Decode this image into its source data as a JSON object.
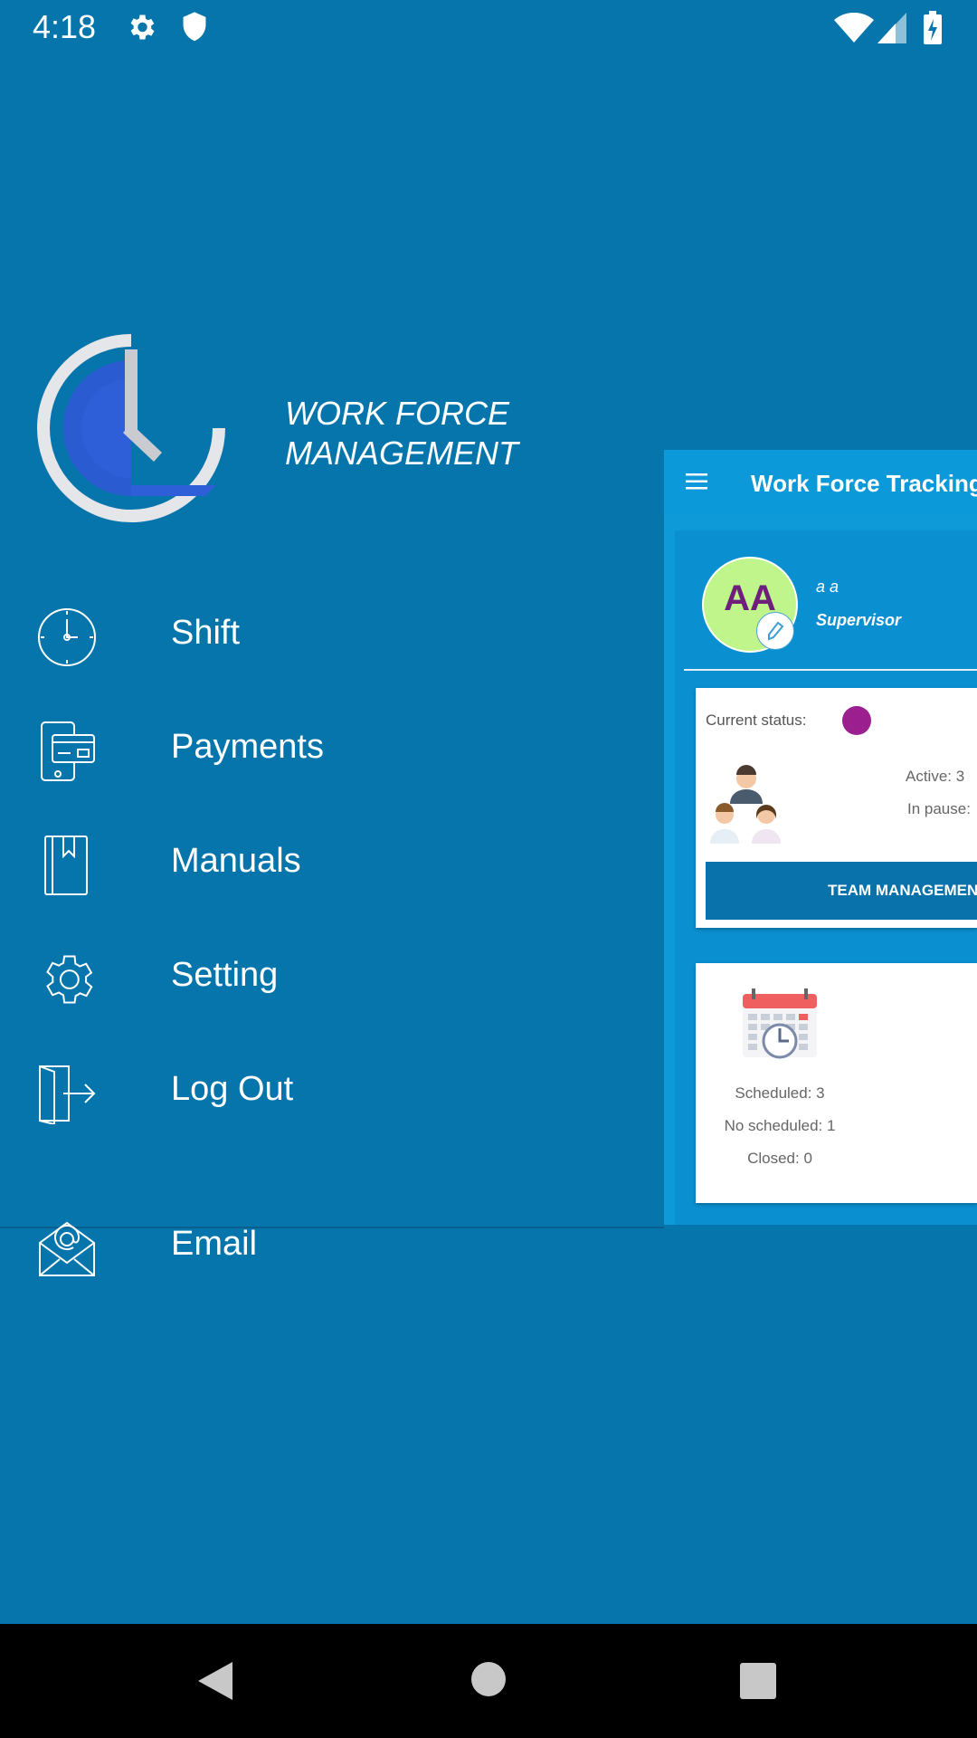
{
  "status_bar": {
    "time": "4:18",
    "icons": [
      "gear-icon",
      "shield-icon",
      "wifi-icon",
      "signal-icon",
      "battery-charging-icon"
    ]
  },
  "drawer": {
    "brand_line1": "WORK FORCE",
    "brand_line2": "MANAGEMENT",
    "menu": [
      {
        "label": "Shift",
        "icon": "clock-icon"
      },
      {
        "label": "Payments",
        "icon": "payments-icon"
      },
      {
        "label": "Manuals",
        "icon": "book-icon"
      },
      {
        "label": "Setting",
        "icon": "gear-icon"
      },
      {
        "label": "Log Out",
        "icon": "logout-icon"
      }
    ],
    "email": {
      "label": "Email",
      "icon": "email-icon"
    }
  },
  "main": {
    "title": "Work Force Tracking",
    "profile": {
      "initials": "AA",
      "name": "a a",
      "role": "Supervisor"
    },
    "status_card": {
      "current_status_label": "Current status:",
      "active": "Active: 3",
      "in_pause": "In pause:",
      "button_label": "TEAM MANAGEMENT"
    },
    "schedule_card": {
      "scheduled": "Scheduled: 3",
      "no_scheduled": "No scheduled: 1",
      "closed": "Closed: 0"
    }
  },
  "colors": {
    "background": "#0575ab",
    "appbar": "#0c99da",
    "status_dot": "#9b1f8f",
    "avatar": "#bff58a",
    "button": "#0a72aa"
  }
}
